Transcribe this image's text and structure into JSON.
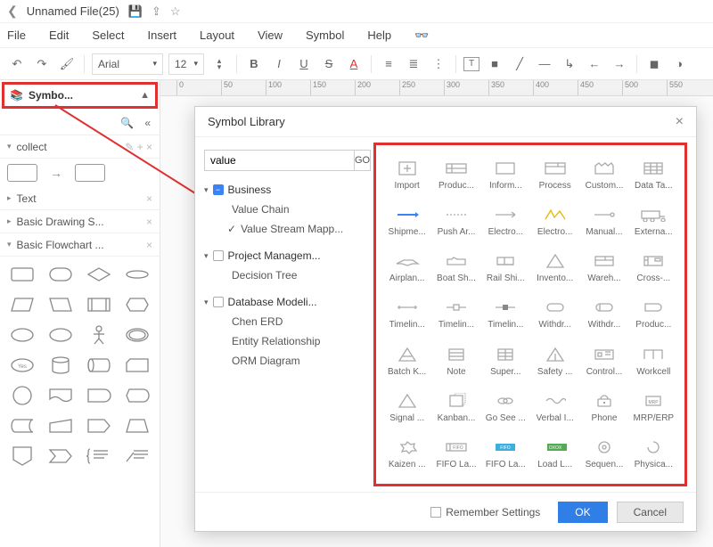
{
  "title": "Unnamed File(25)",
  "menu": [
    "File",
    "Edit",
    "Select",
    "Insert",
    "Layout",
    "View",
    "Symbol",
    "Help"
  ],
  "font": "Arial",
  "fontsize": "12",
  "sidebar": {
    "header": "Symbo...",
    "sections": {
      "collect": "collect",
      "text": "Text",
      "basicdraw": "Basic Drawing S...",
      "basicflow": "Basic Flowchart ..."
    }
  },
  "modal": {
    "title": "Symbol Library",
    "search": "value",
    "go": "GO",
    "tree": {
      "business": "Business",
      "valuechain": "Value Chain",
      "vsm": "Value Stream Mapp...",
      "pm": "Project Managem...",
      "decision": "Decision Tree",
      "db": "Database Modeli...",
      "chen": "Chen ERD",
      "er": "Entity Relationship",
      "orm": "ORM Diagram"
    },
    "symbols": [
      "Import",
      "Produc...",
      "Inform...",
      "Process",
      "Custom...",
      "Data Ta...",
      "Shipme...",
      "Push Ar...",
      "Electro...",
      "Electro...",
      "Manual...",
      "Externa...",
      "Airplan...",
      "Boat Sh...",
      "Rail Shi...",
      "Invento...",
      "Wareh...",
      "Cross-...",
      "Timelin...",
      "Timelin...",
      "Timelin...",
      "Withdr...",
      "Withdr...",
      "Produc...",
      "Batch K...",
      "Note",
      "Super...",
      "Safety ...",
      "Control...",
      "Workcell",
      "Signal ...",
      "Kanban...",
      "Go See ...",
      "Verbal I...",
      "Phone",
      "MRP/ERP",
      "Kaizen ...",
      "FIFO La...",
      "FIFO La...",
      "Load L...",
      "Sequen...",
      "Physica..."
    ],
    "remember": "Remember Settings",
    "ok": "OK",
    "cancel": "Cancel"
  },
  "ruler": [
    "0",
    "50",
    "100",
    "150",
    "200",
    "250",
    "300",
    "350",
    "400",
    "450",
    "500",
    "550"
  ]
}
